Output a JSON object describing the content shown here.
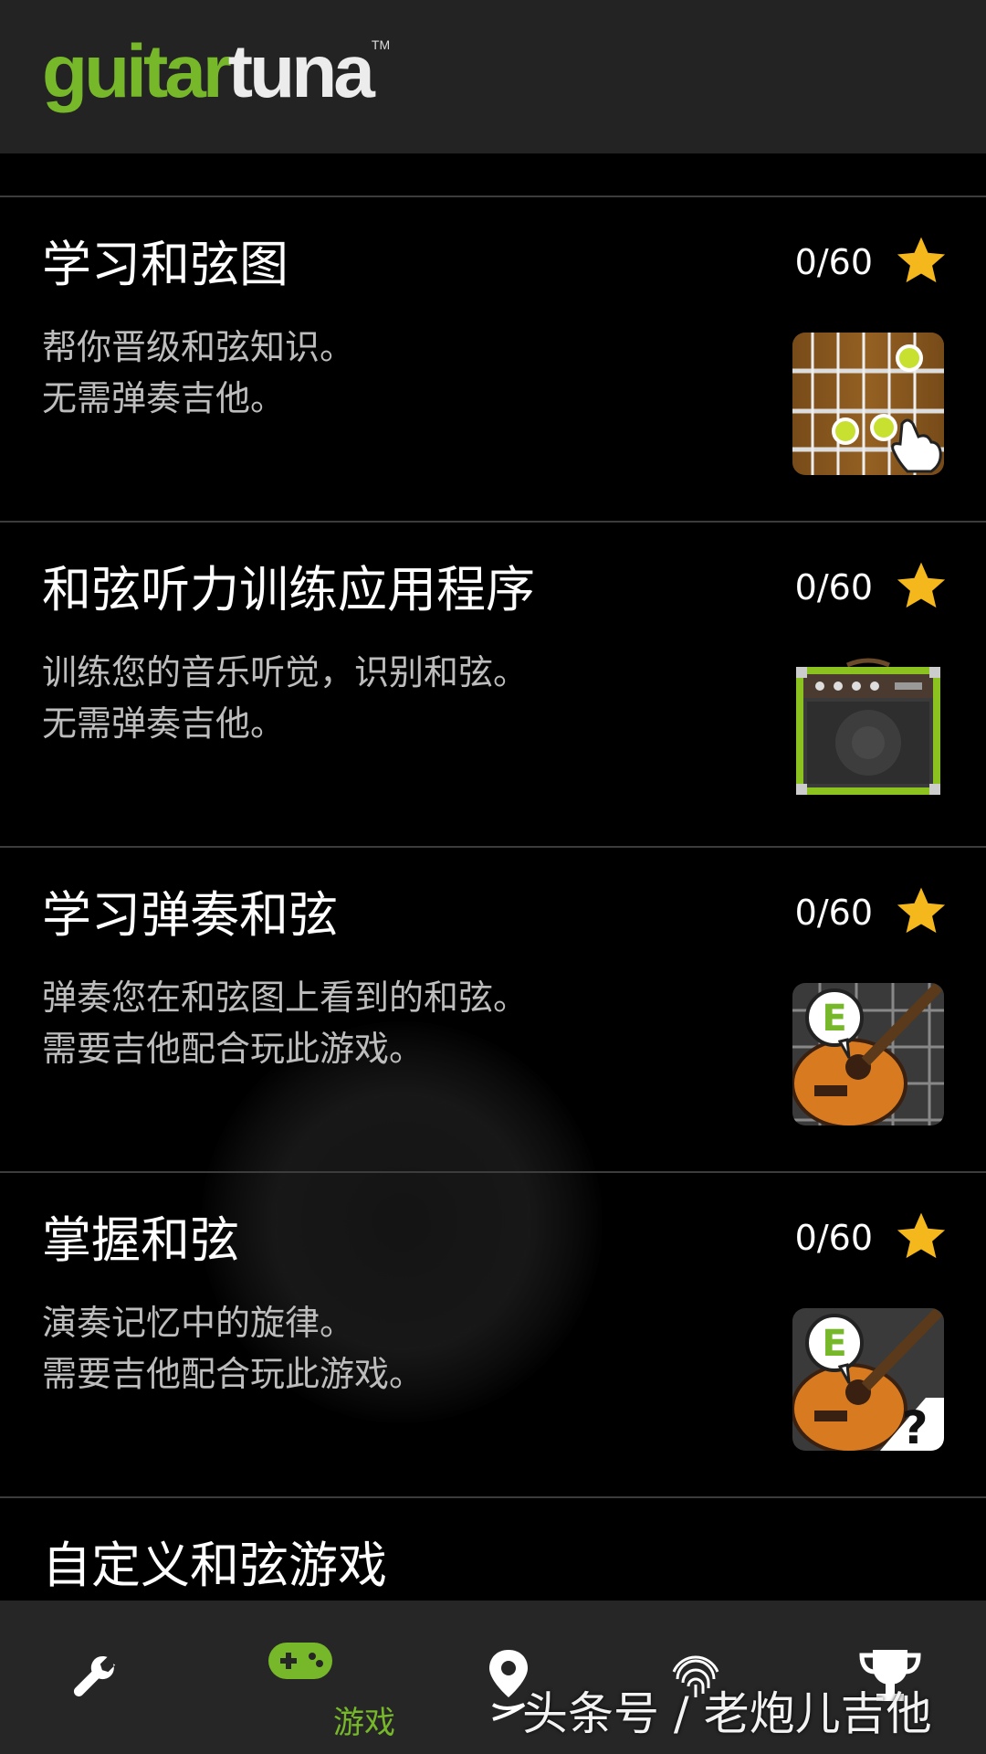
{
  "header": {
    "logo_part1": "guitar",
    "logo_part2": "tuna",
    "logo_tm": "TM"
  },
  "games": [
    {
      "title": "学习和弦图",
      "desc_line1": "帮你晋级和弦知识。",
      "desc_line2": "无需弹奏吉他。",
      "score": "0/60",
      "icon": "fretboard-icon"
    },
    {
      "title": "和弦听力训练应用程序",
      "desc_line1": "训练您的音乐听觉，识别和弦。",
      "desc_line2": "无需弹奏吉他。",
      "score": "0/60",
      "icon": "amplifier-icon"
    },
    {
      "title": "学习弹奏和弦",
      "desc_line1": "弹奏您在和弦图上看到的和弦。",
      "desc_line2": "需要吉他配合玩此游戏。",
      "score": "0/60",
      "icon": "guitar-chord-icon"
    },
    {
      "title": "掌握和弦",
      "desc_line1": "演奏记忆中的旋律。",
      "desc_line2": "需要吉他配合玩此游戏。",
      "score": "0/60",
      "icon": "guitar-question-icon"
    },
    {
      "title": "自定义和弦游戏"
    }
  ],
  "bottom_nav": {
    "items": [
      {
        "icon": "wrench-icon",
        "label": ""
      },
      {
        "icon": "gamepad-icon",
        "label": "游戏",
        "active": true
      },
      {
        "icon": "map-pin-icon",
        "label": ""
      },
      {
        "icon": "trophy-icon",
        "label": ""
      }
    ]
  },
  "watermark": "头条号 / 老炮儿吉他",
  "colors": {
    "accent_green": "#76b82a",
    "star_yellow": "#f5b81c",
    "header_bg": "#232323",
    "nav_bg": "#262626"
  }
}
